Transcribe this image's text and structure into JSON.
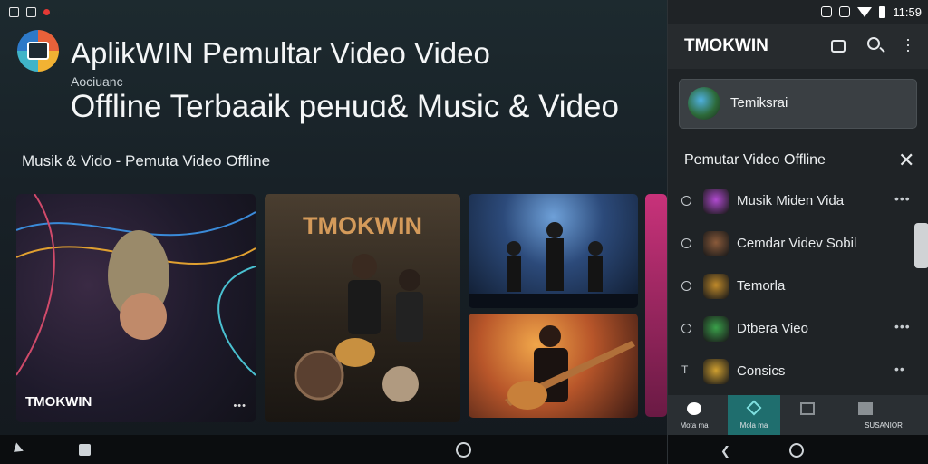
{
  "status_bar": {
    "time": "11:59"
  },
  "app": {
    "title_line1": "AplikWIN Pemultar Video Video",
    "subtitle": "Aociuanc",
    "title_line2": "Offline Terbaaik peнuɑ& Music & Video",
    "section_label": "Musik & Vido - Pemuta Video Offline"
  },
  "cards": [
    {
      "label": "TMOKWIN",
      "more": "•••"
    },
    {
      "label": "TMOKWIN"
    },
    {},
    {}
  ],
  "panel": {
    "title": "TMOKWIN",
    "profile_name": "Temiksrai",
    "section_head": "Pemutar Video Offline",
    "close_symbol": "✕",
    "items": [
      {
        "label": "Musik Miden Vida",
        "more": "•••",
        "thumb_color": "#b04ad0",
        "lead": "o"
      },
      {
        "label": "Cemdar Videv Sobil",
        "more": "",
        "thumb_color": "#8a5a3a",
        "lead": "o"
      },
      {
        "label": "Temorla",
        "more": "",
        "thumb_color": "#c08a2a",
        "lead": "o"
      },
      {
        "label": "Dtbera Vieo",
        "more": "•••",
        "thumb_color": "#3aa04a",
        "lead": "o"
      },
      {
        "label": "Consics",
        "more": "••",
        "thumb_color": "#d0a030",
        "lead": "t"
      }
    ],
    "bottom_nav": [
      {
        "label": "Mota ma",
        "icon": "flower-icon"
      },
      {
        "label": "Mola ma",
        "icon": "diamond-icon"
      },
      {
        "label": "",
        "icon": "box-icon"
      },
      {
        "label": "SUSANIOR",
        "icon": "folder-icon"
      }
    ]
  },
  "colors": {
    "accent": "#1f6e6e",
    "panel_bg": "#1f2326"
  }
}
